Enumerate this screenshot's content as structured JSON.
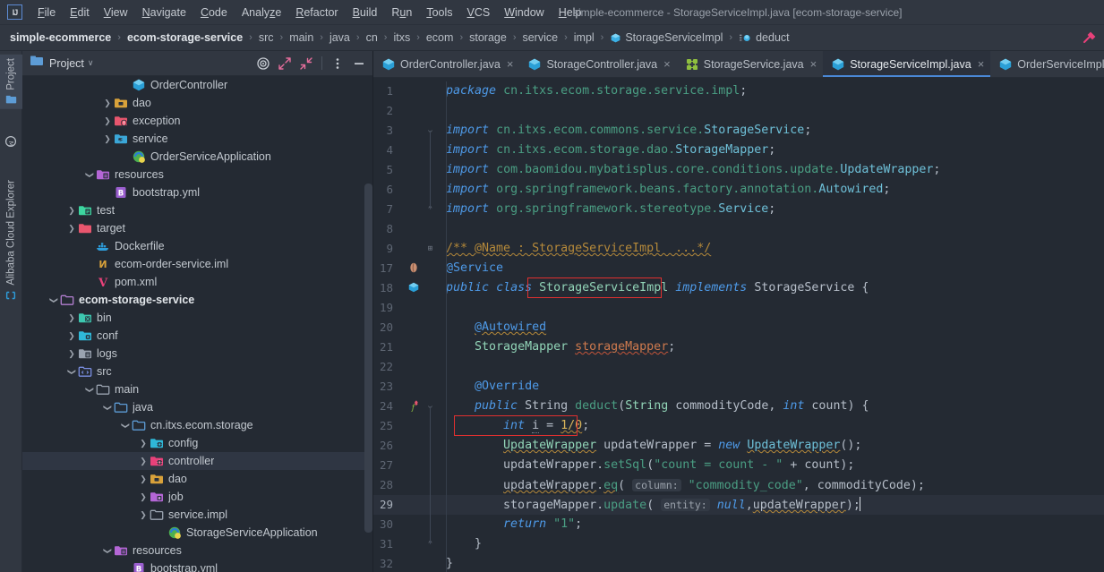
{
  "window": {
    "title": "simple-ecommerce - StorageServiceImpl.java [ecom-storage-service]",
    "logo": "IJ"
  },
  "menubar": {
    "items": [
      {
        "label": "File",
        "mnemonic": "F"
      },
      {
        "label": "Edit",
        "mnemonic": "E"
      },
      {
        "label": "View",
        "mnemonic": "V"
      },
      {
        "label": "Navigate",
        "mnemonic": "N"
      },
      {
        "label": "Code",
        "mnemonic": "C"
      },
      {
        "label": "Analyze",
        "mnemonic": "z"
      },
      {
        "label": "Refactor",
        "mnemonic": "R"
      },
      {
        "label": "Build",
        "mnemonic": "B"
      },
      {
        "label": "Run",
        "mnemonic": "u"
      },
      {
        "label": "Tools",
        "mnemonic": "T"
      },
      {
        "label": "VCS",
        "mnemonic": "V"
      },
      {
        "label": "Window",
        "mnemonic": "W"
      },
      {
        "label": "Help",
        "mnemonic": "H"
      }
    ]
  },
  "breadcrumb": {
    "separator": "›",
    "items": [
      {
        "label": "simple-ecommerce",
        "bold": true,
        "icon": "none"
      },
      {
        "label": "ecom-storage-service",
        "bold": true,
        "icon": "none"
      },
      {
        "label": "src",
        "bold": false,
        "icon": "none"
      },
      {
        "label": "main",
        "bold": false,
        "icon": "none"
      },
      {
        "label": "java",
        "bold": false,
        "icon": "none"
      },
      {
        "label": "cn",
        "bold": false,
        "icon": "none"
      },
      {
        "label": "itxs",
        "bold": false,
        "icon": "none"
      },
      {
        "label": "ecom",
        "bold": false,
        "icon": "none"
      },
      {
        "label": "storage",
        "bold": false,
        "icon": "none"
      },
      {
        "label": "service",
        "bold": false,
        "icon": "none"
      },
      {
        "label": "impl",
        "bold": false,
        "icon": "none"
      },
      {
        "label": "StorageServiceImpl",
        "bold": false,
        "icon": "class-icon"
      },
      {
        "label": "deduct",
        "bold": false,
        "icon": "method-icon"
      }
    ],
    "right_icon": "hammer-icon"
  },
  "stripe": {
    "buttons": [
      {
        "label": "Project",
        "icon": "project-icon",
        "selected": true
      },
      {
        "label": "Alibaba Cloud Explorer",
        "icon": "cloud-icon",
        "selected": false
      }
    ]
  },
  "project_panel": {
    "title": "Project",
    "dropdown": "∨",
    "tools": [
      {
        "name": "locate-icon",
        "label": "Select Opened File"
      },
      {
        "name": "expand-all-icon",
        "label": "Expand All"
      },
      {
        "name": "collapse-all-icon",
        "label": "Collapse All"
      },
      {
        "name": "more-options-icon",
        "label": "Options"
      },
      {
        "name": "hide-icon",
        "label": "Hide"
      }
    ],
    "tree": [
      {
        "label": "OrderController",
        "indent": 5,
        "arrow": "none",
        "icon": "class-icon",
        "selected": false,
        "bold": false
      },
      {
        "label": "dao",
        "indent": 4,
        "arrow": "closed",
        "icon": "folder-dao",
        "selected": false,
        "bold": false
      },
      {
        "label": "exception",
        "indent": 4,
        "arrow": "closed",
        "icon": "folder-exception",
        "selected": false,
        "bold": false
      },
      {
        "label": "service",
        "indent": 4,
        "arrow": "closed",
        "icon": "folder-service",
        "selected": false,
        "bold": false
      },
      {
        "label": "OrderServiceApplication",
        "indent": 5,
        "arrow": "none",
        "icon": "spring-app-icon",
        "selected": false,
        "bold": false
      },
      {
        "label": "resources",
        "indent": 3,
        "arrow": "open",
        "icon": "folder-resources",
        "selected": false,
        "bold": false
      },
      {
        "label": "bootstrap.yml",
        "indent": 4,
        "arrow": "none",
        "icon": "yml-icon",
        "selected": false,
        "bold": false
      },
      {
        "label": "test",
        "indent": 2,
        "arrow": "closed",
        "icon": "folder-test",
        "selected": false,
        "bold": false
      },
      {
        "label": "target",
        "indent": 2,
        "arrow": "closed",
        "icon": "folder-target",
        "selected": false,
        "bold": false
      },
      {
        "label": "Dockerfile",
        "indent": 3,
        "arrow": "none",
        "icon": "docker-icon",
        "selected": false,
        "bold": false
      },
      {
        "label": "ecom-order-service.iml",
        "indent": 3,
        "arrow": "none",
        "icon": "iml-icon",
        "selected": false,
        "bold": false
      },
      {
        "label": "pom.xml",
        "indent": 3,
        "arrow": "none",
        "icon": "maven-icon",
        "selected": false,
        "bold": false
      },
      {
        "label": "ecom-storage-service",
        "indent": 1,
        "arrow": "open",
        "icon": "module-icon",
        "selected": false,
        "bold": true
      },
      {
        "label": "bin",
        "indent": 2,
        "arrow": "closed",
        "icon": "folder-bin",
        "selected": false,
        "bold": false
      },
      {
        "label": "conf",
        "indent": 2,
        "arrow": "closed",
        "icon": "folder-conf",
        "selected": false,
        "bold": false
      },
      {
        "label": "logs",
        "indent": 2,
        "arrow": "closed",
        "icon": "folder-logs",
        "selected": false,
        "bold": false
      },
      {
        "label": "src",
        "indent": 2,
        "arrow": "open",
        "icon": "folder-src",
        "selected": false,
        "bold": false
      },
      {
        "label": "main",
        "indent": 3,
        "arrow": "open",
        "icon": "folder-plain",
        "selected": false,
        "bold": false
      },
      {
        "label": "java",
        "indent": 4,
        "arrow": "open",
        "icon": "folder-java",
        "selected": false,
        "bold": false
      },
      {
        "label": "cn.itxs.ecom.storage",
        "indent": 5,
        "arrow": "open",
        "icon": "folder-package",
        "selected": false,
        "bold": false
      },
      {
        "label": "config",
        "indent": 6,
        "arrow": "closed",
        "icon": "folder-config",
        "selected": false,
        "bold": false
      },
      {
        "label": "controller",
        "indent": 6,
        "arrow": "closed",
        "icon": "folder-controller",
        "selected": true,
        "bold": false
      },
      {
        "label": "dao",
        "indent": 6,
        "arrow": "closed",
        "icon": "folder-dao",
        "selected": false,
        "bold": false
      },
      {
        "label": "job",
        "indent": 6,
        "arrow": "closed",
        "icon": "folder-job",
        "selected": false,
        "bold": false
      },
      {
        "label": "service.impl",
        "indent": 6,
        "arrow": "closed",
        "icon": "folder-plain",
        "selected": false,
        "bold": false
      },
      {
        "label": "StorageServiceApplication",
        "indent": 7,
        "arrow": "none",
        "icon": "spring-app-icon",
        "selected": false,
        "bold": false
      },
      {
        "label": "resources",
        "indent": 4,
        "arrow": "open",
        "icon": "folder-resources",
        "selected": false,
        "bold": false
      },
      {
        "label": "bootstrap.yml",
        "indent": 5,
        "arrow": "none",
        "icon": "yml-icon",
        "selected": false,
        "bold": false
      }
    ]
  },
  "editor_tabs": [
    {
      "label": "OrderController.java",
      "icon": "class-icon",
      "active": false,
      "close": "×"
    },
    {
      "label": "StorageController.java",
      "icon": "class-icon",
      "active": false,
      "close": "×"
    },
    {
      "label": "StorageService.java",
      "icon": "interface-icon",
      "active": false,
      "close": "×"
    },
    {
      "label": "StorageServiceImpl.java",
      "icon": "class-icon",
      "active": true,
      "close": "×"
    },
    {
      "label": "OrderServiceImpl",
      "icon": "class-icon",
      "active": false,
      "close": ""
    }
  ],
  "editor": {
    "filename": "StorageServiceImpl.java",
    "current_line": 29,
    "line_numbers": [
      1,
      2,
      3,
      4,
      5,
      6,
      7,
      8,
      9,
      17,
      18,
      19,
      20,
      21,
      22,
      23,
      24,
      25,
      26,
      27,
      28,
      29,
      30,
      31,
      32
    ],
    "gutter_icons": [
      {
        "line_index": 9,
        "name": "spring-bean-icon"
      },
      {
        "line_index": 10,
        "name": "class-marker-icon"
      },
      {
        "line_index": 16,
        "name": "implementing-method-icon"
      }
    ],
    "code_lines": [
      {
        "n": 1,
        "text": "package cn.itxs.ecom.storage.service.impl;"
      },
      {
        "n": 2,
        "text": ""
      },
      {
        "n": 3,
        "text": "import cn.itxs.ecom.commons.service.StorageService;"
      },
      {
        "n": 4,
        "text": "import cn.itxs.ecom.storage.dao.StorageMapper;"
      },
      {
        "n": 5,
        "text": "import com.baomidou.mybatisplus.core.conditions.update.UpdateWrapper;"
      },
      {
        "n": 6,
        "text": "import org.springframework.beans.factory.annotation.Autowired;"
      },
      {
        "n": 7,
        "text": "import org.springframework.stereotype.Service;"
      },
      {
        "n": 8,
        "text": ""
      },
      {
        "n": 9,
        "text": "/** @Name : StorageServiceImpl  ...*/"
      },
      {
        "n": 17,
        "text": "@Service"
      },
      {
        "n": 18,
        "text": "public class StorageServiceImpl implements StorageService {"
      },
      {
        "n": 19,
        "text": ""
      },
      {
        "n": 20,
        "text": "    @Autowired"
      },
      {
        "n": 21,
        "text": "    StorageMapper storageMapper;"
      },
      {
        "n": 22,
        "text": ""
      },
      {
        "n": 23,
        "text": "    @Override"
      },
      {
        "n": 24,
        "text": "    public String deduct(String commodityCode, int count) {"
      },
      {
        "n": 25,
        "text": "        int i = 1/0;"
      },
      {
        "n": 26,
        "text": "        UpdateWrapper updateWrapper = new UpdateWrapper();"
      },
      {
        "n": 27,
        "text": "        updateWrapper.setSql(\"count = count - \" + count);"
      },
      {
        "n": 28,
        "text": "        updateWrapper.eq( column: \"commodity_code\", commodityCode);"
      },
      {
        "n": 29,
        "text": "        storageMapper.update( entity: null,updateWrapper);"
      },
      {
        "n": 30,
        "text": "        return \"1\";"
      },
      {
        "n": 31,
        "text": "    }"
      },
      {
        "n": 32,
        "text": "}"
      }
    ],
    "inlay_hints": [
      {
        "line": 28,
        "text": "column:"
      },
      {
        "line": 29,
        "text": "entity:"
      }
    ],
    "highlight_boxes": [
      {
        "line": 18,
        "text": "StorageServiceImpl",
        "color": "#e03030"
      },
      {
        "line": 25,
        "text": "int i = 1/0;",
        "color": "#e03030"
      }
    ]
  },
  "colors": {
    "bg_editor": "#242a33",
    "bg_panel": "#313741",
    "accent_blue": "#4a88d6",
    "error_red": "#e03030",
    "keyword": "#4e9ae8",
    "string": "#4a9e83",
    "comment": "#b5893a",
    "number": "#d8b45a",
    "field": "#cf7a4e",
    "class_name": "#92d5b8"
  }
}
